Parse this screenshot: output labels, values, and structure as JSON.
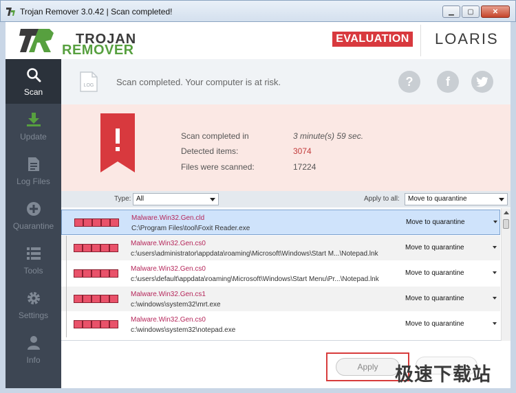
{
  "window": {
    "title": "Trojan Remover 3.0.42 | Scan completed!",
    "minimize": "▁",
    "maximize": "▢",
    "close": "✕"
  },
  "header": {
    "logo_line1": "TROJAN",
    "logo_line2": "REMOVER",
    "evaluation": "EVALUATION",
    "brand": "LOARIS"
  },
  "sidebar": {
    "items": [
      {
        "label": "Scan",
        "icon": "search-icon"
      },
      {
        "label": "Update",
        "icon": "download-icon"
      },
      {
        "label": "Log Files",
        "icon": "document-icon"
      },
      {
        "label": "Quarantine",
        "icon": "plus-circle-icon"
      },
      {
        "label": "Tools",
        "icon": "list-icon"
      },
      {
        "label": "Settings",
        "icon": "gear-icon"
      },
      {
        "label": "Info",
        "icon": "user-icon"
      }
    ]
  },
  "status": {
    "log_label": "LOG",
    "message": "Scan completed. Your computer is at risk.",
    "help": "?",
    "facebook": "f",
    "twitter": "t"
  },
  "summary": {
    "rows": [
      {
        "label": "Scan completed in",
        "value": "3 minute(s) 59 sec."
      },
      {
        "label": "Detected items:",
        "value": "3074"
      },
      {
        "label": "Files were scanned:",
        "value": "17224"
      }
    ],
    "colors": {
      "danger": "#d8393e",
      "threat_text": "#b5265a"
    }
  },
  "filters": {
    "type_label": "Type:",
    "type_value": "All",
    "apply_all_label": "Apply to all:",
    "apply_all_value": "Move to quarantine"
  },
  "threats": [
    {
      "name": "Malware.Win32.Gen.cld",
      "path": "C:\\Program Files\\tool\\Foxit Reader.exe",
      "action": "Move to quarantine"
    },
    {
      "name": "Malware.Win32.Gen.cs0",
      "path": "c:\\users\\administrator\\appdata\\roaming\\Microsoft\\Windows\\Start M...\\Notepad.lnk",
      "action": "Move to quarantine"
    },
    {
      "name": "Malware.Win32.Gen.cs0",
      "path": "c:\\users\\default\\appdata\\roaming\\Microsoft\\Windows\\Start Menu\\Pr...\\Notepad.lnk",
      "action": "Move to quarantine"
    },
    {
      "name": "Malware.Win32.Gen.cs1",
      "path": "c:\\windows\\system32\\mrt.exe",
      "action": "Move to quarantine"
    },
    {
      "name": "Malware.Win32.Gen.cs0",
      "path": "c:\\windows\\system32\\notepad.exe",
      "action": "Move to quarantine"
    }
  ],
  "footer": {
    "apply": "Apply",
    "watermark": "极速下载站"
  }
}
